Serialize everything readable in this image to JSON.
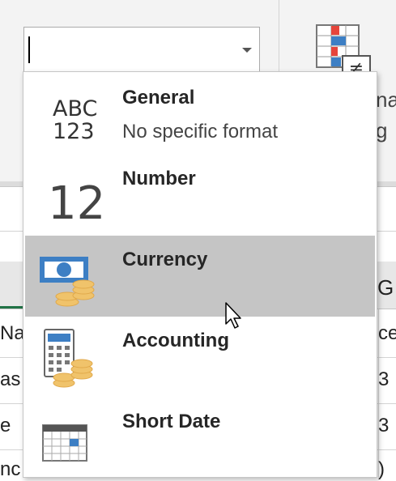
{
  "combo": {
    "value": ""
  },
  "background": {
    "column_letter": "G",
    "right_fragments": [
      "na",
      "g"
    ],
    "left_cells": [
      "Na",
      "as",
      "e",
      "nc"
    ],
    "right_cells": [
      "ce",
      "3",
      "3",
      ")"
    ]
  },
  "number_format_menu": {
    "items": [
      {
        "label": "General",
        "sublabel": "No specific format",
        "icon": "abc-123-icon",
        "icon_text_top": "ABC",
        "icon_text_bottom": "123"
      },
      {
        "label": "Number",
        "sublabel": "",
        "icon": "number-12-icon",
        "icon_text": "12"
      },
      {
        "label": "Currency",
        "sublabel": "",
        "icon": "currency-icon",
        "highlighted": true
      },
      {
        "label": "Accounting",
        "sublabel": "",
        "icon": "accounting-icon"
      },
      {
        "label": "Short Date",
        "sublabel": "",
        "icon": "calendar-icon"
      }
    ]
  },
  "colors": {
    "highlight": "#c5c5c5",
    "accent_blue": "#3d7fc4",
    "coin_gold": "#f0c36b",
    "excel_green": "#217346"
  }
}
